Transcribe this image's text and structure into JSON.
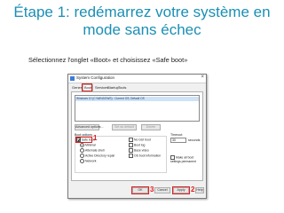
{
  "slide": {
    "title": "Étape 1: redémarrez votre système en mode sans échec",
    "subtitle": "Sélectionnez l'onglet «Boot» et choisissez «Safe boot»"
  },
  "window": {
    "title": "System Configuration",
    "close_glyph": "×",
    "tabs": [
      {
        "label": "General"
      },
      {
        "label": "Boot"
      },
      {
        "label": "Services"
      },
      {
        "label": "Startup"
      },
      {
        "label": "Tools"
      }
    ],
    "os_entry": "Windows 10 (C:\\WINDOWS) : Current OS; Default OS",
    "buttons": {
      "advanced": "Advanced options...",
      "set_default": "Set as default",
      "delete": "Delete",
      "ok": "OK",
      "cancel": "Cancel",
      "apply": "Apply",
      "help": "Help"
    },
    "boot_options": {
      "label": "Boot options",
      "safe_boot": "Safe boot",
      "minimal": "Minimal",
      "alternate_shell": "Alternate shell",
      "ad_repair": "Active Directory repair",
      "network": "Network",
      "no_gui": "No GUI boot",
      "boot_log": "Boot log",
      "base_video": "Base video",
      "os_boot_info": "OS boot information"
    },
    "timeout": {
      "label": "Timeout:",
      "value": "30",
      "unit": "seconds"
    },
    "make_permanent": "Make all boot settings permanent"
  },
  "annotations": {
    "one": "1",
    "two": "2",
    "three": "3",
    "color": "#e02020"
  }
}
